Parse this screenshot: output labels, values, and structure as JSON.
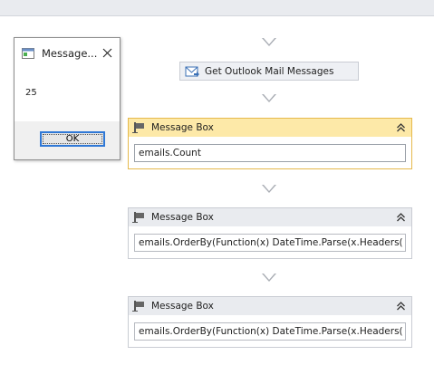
{
  "workflow": {
    "outlook_activity": {
      "label": "Get Outlook Mail Messages"
    },
    "message_boxes": [
      {
        "title": "Message Box",
        "expression": "emails.Count",
        "selected": true
      },
      {
        "title": "Message Box",
        "expression": "emails.OrderBy(Function(x) DateTime.Parse(x.Headers(",
        "selected": false
      },
      {
        "title": "Message Box",
        "expression": "emails.OrderBy(Function(x) DateTime.Parse(x.Headers(",
        "selected": false
      }
    ]
  },
  "dialog": {
    "title": "Message...",
    "message": "25",
    "ok_label": "OK"
  },
  "icons": {
    "outlook": "mail-envelope-icon",
    "message_box": "message-box-flag-icon",
    "collapse": "double-chevron-up-icon",
    "flow_arrow": "down-triangle-icon",
    "dialog_app": "window-app-icon",
    "close": "close-icon"
  },
  "colors": {
    "selected_header": "#fde9a8",
    "selected_border": "#e6b94c",
    "ok_focus_border": "#2f78d6"
  }
}
